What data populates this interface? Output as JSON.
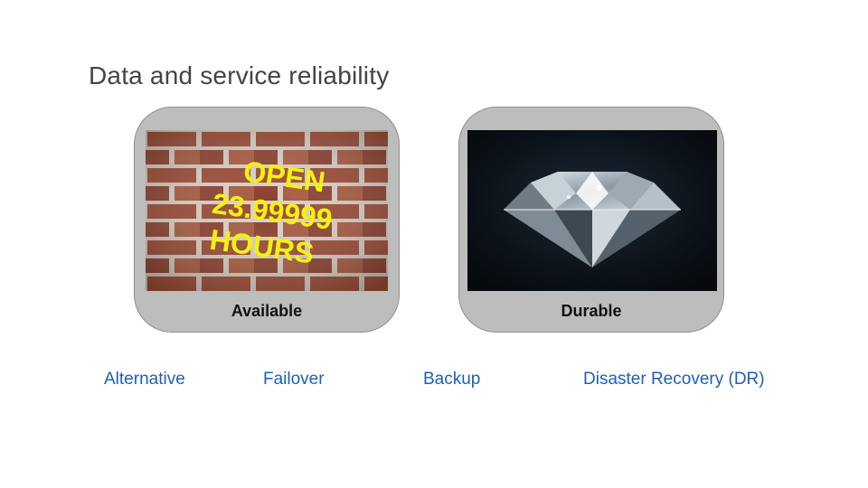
{
  "slide": {
    "title": "Data and service reliability"
  },
  "cards": [
    {
      "label": "Available",
      "sign_lines": [
        "OPEN",
        "23.99999",
        "HOURS"
      ],
      "image": "brick-wall-sign",
      "sign_color": "#f3f20f"
    },
    {
      "label": "Durable",
      "image": "diamond"
    }
  ],
  "links": [
    "Alternative",
    "Failover",
    "Backup",
    "Disaster Recovery (DR)"
  ],
  "colors": {
    "title": "#444444",
    "link": "#1f5fb8",
    "card_bg": "#bdbdbd"
  }
}
